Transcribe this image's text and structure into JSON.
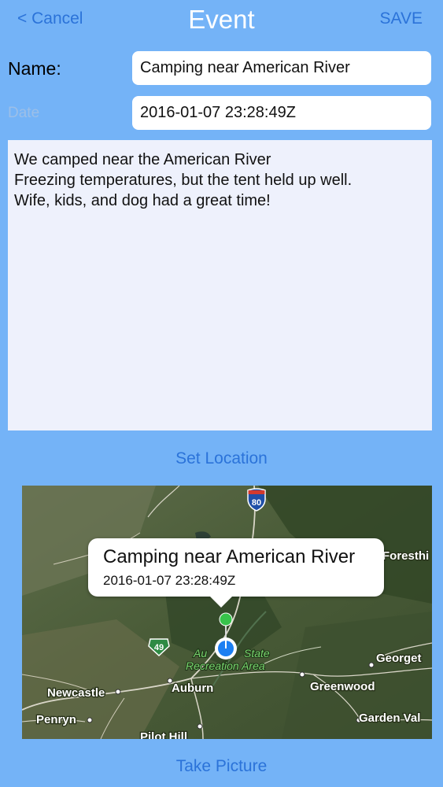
{
  "nav": {
    "cancel_label": "< Cancel",
    "title": "Event",
    "save_label": "SAVE"
  },
  "form": {
    "name_label": "Name:",
    "name_value": "Camping near American River",
    "date_label": "Date",
    "date_value": "2016-01-07 23:28:49Z",
    "notes_lines": [
      "We camped near the American River",
      "Freezing temperatures, but the tent held up well.",
      "Wife, kids, and dog had a great time!"
    ]
  },
  "actions": {
    "set_location": "Set Location",
    "take_picture": "Take Picture"
  },
  "map": {
    "callout_title": "Camping near American River",
    "callout_subtitle": "2016-01-07 23:28:49Z",
    "highway_shields": [
      "80",
      "49"
    ],
    "places": {
      "foresthill": "Foresthi",
      "auburn_park_1": "Au",
      "auburn_park_2": "State",
      "auburn_park_3": "Recreation Area",
      "georgetown": "Georget",
      "auburn": "Auburn",
      "greenwood": "Greenwood",
      "newcastle": "Newcastle",
      "penryn": "Penryn",
      "garden_valley": "Garden Val",
      "pilot_hill": "Pilot Hill"
    }
  },
  "colors": {
    "background": "#74b3f7",
    "link": "#2b73d9",
    "pin_user": "#1c7ff2",
    "pin_event": "#37c34a"
  }
}
